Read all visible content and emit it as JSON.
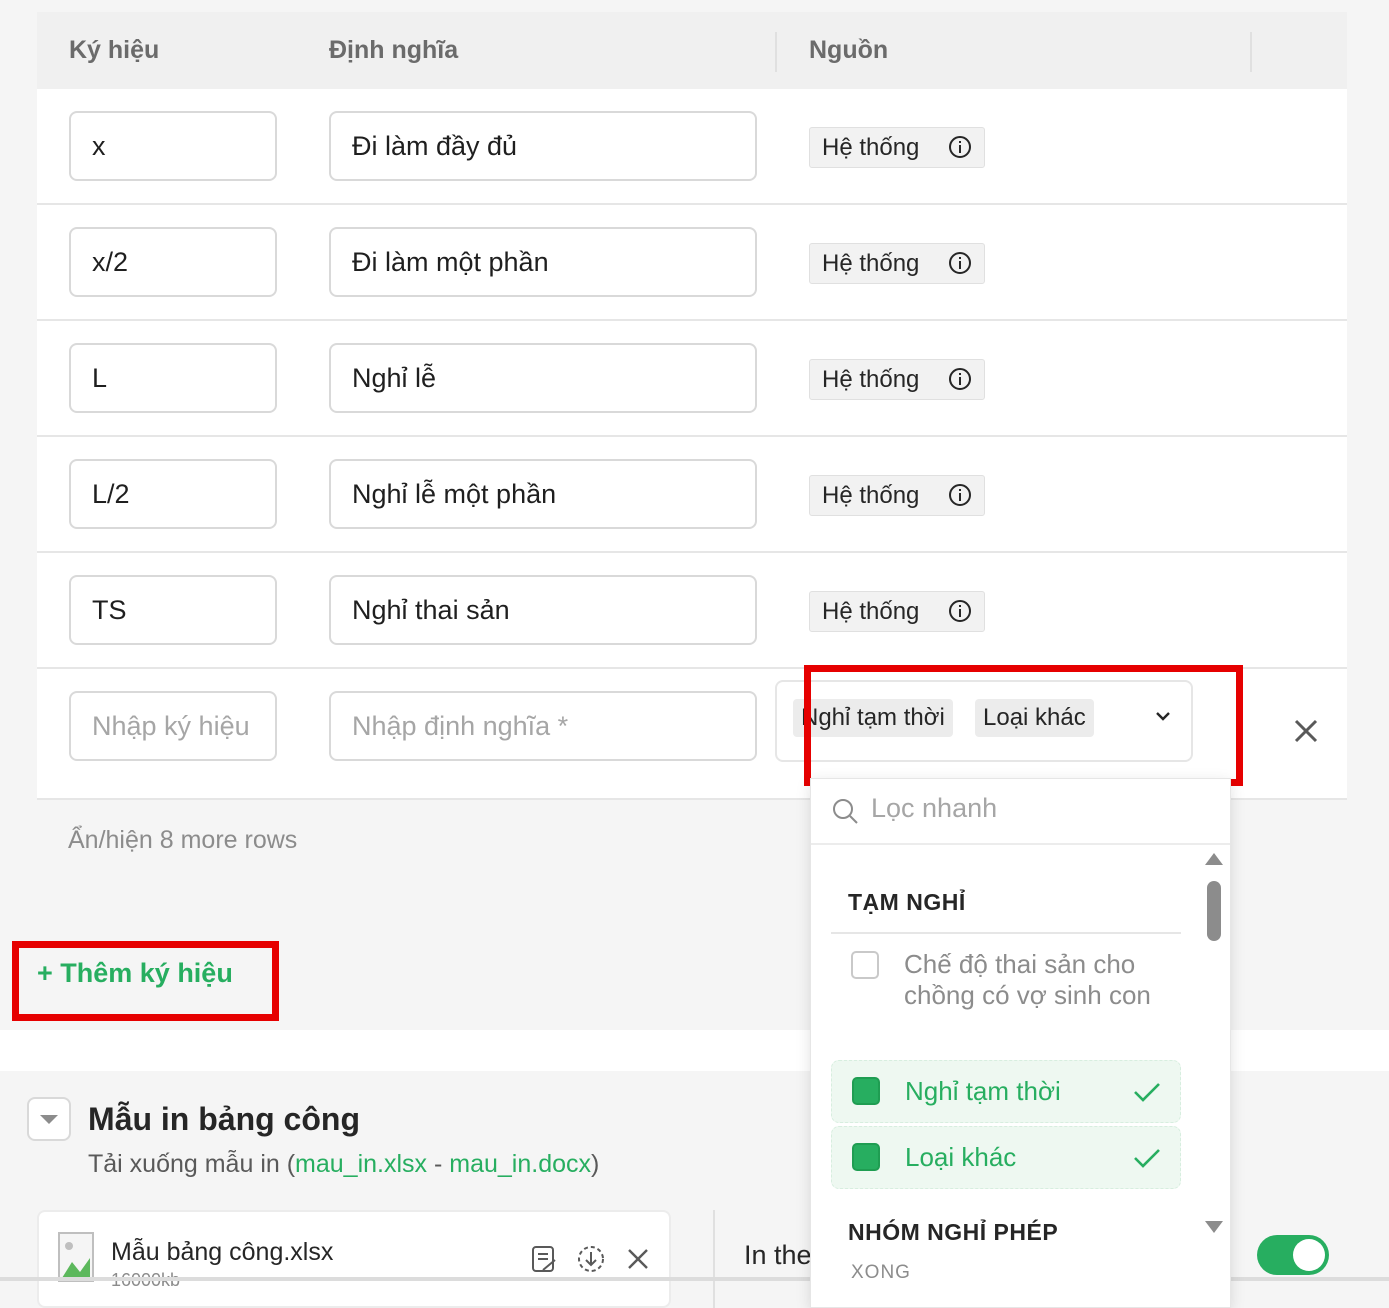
{
  "table": {
    "headers": {
      "symbol": "Ký hiệu",
      "definition": "Định nghĩa",
      "source": "Nguồn"
    },
    "rows": [
      {
        "symbol": "x",
        "definition": "Đi làm đầy đủ",
        "source": "Hệ thống"
      },
      {
        "symbol": "x/2",
        "definition": "Đi làm một phần",
        "source": "Hệ thống"
      },
      {
        "symbol": "L",
        "definition": "Nghỉ lễ",
        "source": "Hệ thống"
      },
      {
        "symbol": "L/2",
        "definition": "Nghỉ lễ một phần",
        "source": "Hệ thống"
      },
      {
        "symbol": "TS",
        "definition": "Nghỉ thai sản",
        "source": "Hệ thống"
      }
    ],
    "new_row": {
      "symbol_placeholder": "Nhập ký hiệu",
      "definition_placeholder": "Nhập định nghĩa *",
      "selected_chips": [
        "Nghỉ tạm thời",
        "Loại khác"
      ]
    },
    "toggle_rows_label": "Ẩn/hiện 8 more rows",
    "add_symbol_label": "+ Thêm ký hiệu"
  },
  "dropdown": {
    "search_placeholder": "Lọc nhanh",
    "group1": "TẠM NGHỈ",
    "options": [
      {
        "label": "Chế độ thai sản cho chồng có vợ sinh con",
        "checked": false
      },
      {
        "label": "Nghỉ tạm thời",
        "checked": true
      },
      {
        "label": "Loại khác",
        "checked": true
      }
    ],
    "group2": "NHÓM NGHỈ PHÉP",
    "footer": "XONG"
  },
  "print_section": {
    "title": "Mẫu in bảng công",
    "subtitle_prefix": "Tải xuống mẫu in (",
    "link_xlsx": "mau_in.xlsx",
    "separator": " - ",
    "link_docx": "mau_in.docx",
    "subtitle_suffix": ")",
    "file_name": "Mẫu bảng công.xlsx",
    "file_size": "16000kb",
    "print_label": "In the"
  },
  "colors": {
    "accent": "#27ae60",
    "highlight": "#e60000"
  }
}
